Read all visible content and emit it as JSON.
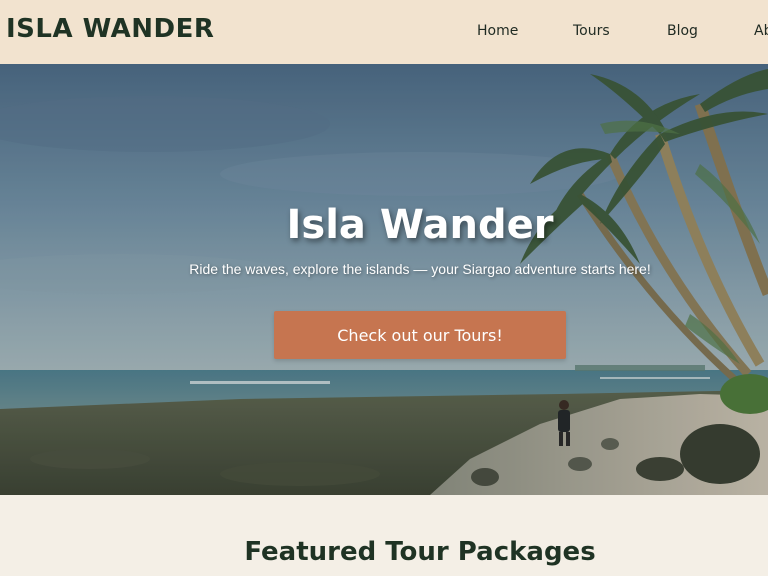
{
  "header": {
    "brand": "ISLA WANDER",
    "nav": [
      {
        "label": "Home"
      },
      {
        "label": "Tours"
      },
      {
        "label": "Blog"
      },
      {
        "label": "About"
      }
    ]
  },
  "hero": {
    "title": "Isla Wander",
    "tagline": "Ride the waves, explore the islands — your Siargao adventure starts here!",
    "cta_label": "Check out our Tours!",
    "image_icon": "beach-photo"
  },
  "featured": {
    "title": "Featured Tour Packages"
  },
  "colors": {
    "header_bg": "#f2e3cf",
    "brand_text": "#1f3324",
    "cta_bg": "#c67550",
    "page_bg": "#f4efe6"
  }
}
